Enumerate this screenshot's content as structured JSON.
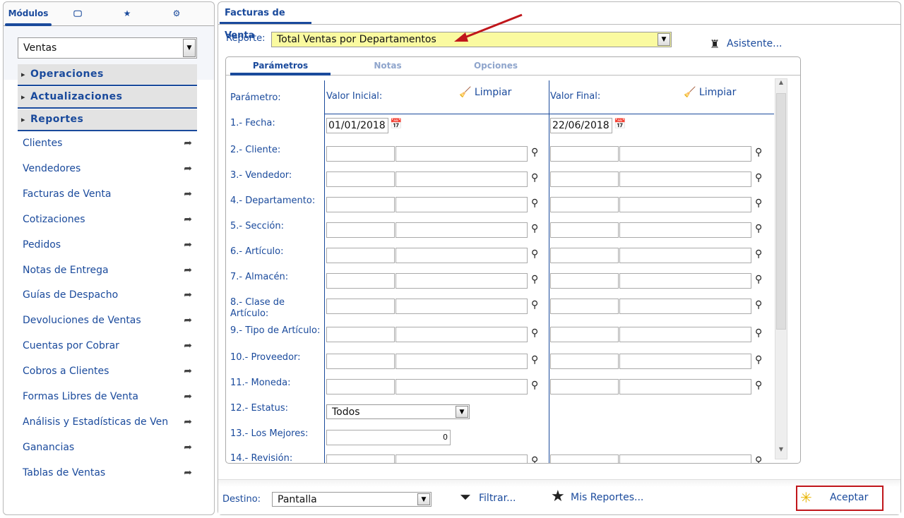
{
  "left": {
    "tabs": [
      {
        "label": "Módulos"
      },
      {
        "icon": "monitor-icon"
      },
      {
        "icon": "star-icon"
      },
      {
        "icon": "settings-icon"
      }
    ],
    "module_select": "Ventas",
    "groups": [
      "Operaciones",
      "Actualizaciones",
      "Reportes"
    ],
    "items": [
      "Clientes",
      "Vendedores",
      "Facturas de Venta",
      "Cotizaciones",
      "Pedidos",
      "Notas de Entrega",
      "Guías de Despacho",
      "Devoluciones de Ventas",
      "Cuentas por Cobrar",
      "Cobros a Clientes",
      "Formas Libres de Venta",
      "Análisis y Estadísticas de Ven",
      "Ganancias",
      "Tablas de Ventas"
    ]
  },
  "main": {
    "tab": "Facturas de Venta",
    "report_label": "Reporte:",
    "report_value": "Total Ventas por Departamentos",
    "wizard": "Asistente...",
    "tabs": [
      "Parámetros",
      "Notas",
      "Opciones"
    ],
    "headers": {
      "param": "Parámetro:",
      "initial": "Valor Inicial:",
      "final": "Valor Final:",
      "clear": "Limpiar"
    },
    "params": [
      {
        "label": "1.- Fecha:",
        "type": "date",
        "initial": "01/01/2018",
        "final": "22/06/2018"
      },
      {
        "label": "2.- Cliente:",
        "type": "range"
      },
      {
        "label": "3.- Vendedor:",
        "type": "range"
      },
      {
        "label": "4.- Departamento:",
        "type": "range"
      },
      {
        "label": "5.- Sección:",
        "type": "range"
      },
      {
        "label": "6.- Artículo:",
        "type": "range"
      },
      {
        "label": "7.- Almacén:",
        "type": "range"
      },
      {
        "label": "8.- Clase de Artículo:",
        "type": "range"
      },
      {
        "label": "9.- Tipo de Artículo:",
        "type": "range"
      },
      {
        "label": "10.- Proveedor:",
        "type": "range"
      },
      {
        "label": "11.- Moneda:",
        "type": "range"
      },
      {
        "label": "12.- Estatus:",
        "type": "select",
        "initial": "Todos"
      },
      {
        "label": "13.- Los Mejores:",
        "type": "number",
        "initial": "0"
      },
      {
        "label": "14.- Revisión:",
        "type": "range"
      }
    ]
  },
  "footer": {
    "dest_label": "Destino:",
    "dest_value": "Pantalla",
    "filter": "Filtrar...",
    "my_reports": "Mis Reportes...",
    "accept": "Aceptar"
  },
  "colors": {
    "accent": "#1a4a9c",
    "highlight": "#fafaa0",
    "arrow": "#c0161b"
  }
}
